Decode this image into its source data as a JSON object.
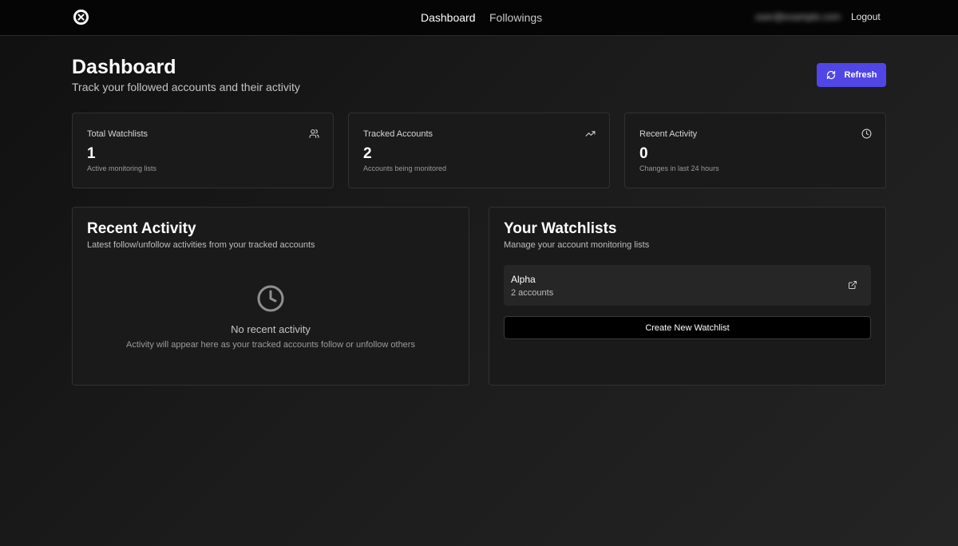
{
  "nav": {
    "items": [
      "Dashboard",
      "Followings"
    ],
    "user_email": "user@example.com",
    "logout_label": "Logout"
  },
  "header": {
    "title": "Dashboard",
    "subtitle": "Track your followed accounts and their activity",
    "refresh_label": "Refresh"
  },
  "stats": [
    {
      "title": "Total Watchlists",
      "value": "1",
      "description": "Active monitoring lists",
      "icon": "users-icon"
    },
    {
      "title": "Tracked Accounts",
      "value": "2",
      "description": "Accounts being monitored",
      "icon": "trending-up-icon"
    },
    {
      "title": "Recent Activity",
      "value": "0",
      "description": "Changes in last 24 hours",
      "icon": "clock-icon"
    }
  ],
  "recent_activity": {
    "title": "Recent Activity",
    "subtitle": "Latest follow/unfollow activities from your tracked accounts",
    "empty_title": "No recent activity",
    "empty_description": "Activity will appear here as your tracked accounts follow or unfollow others"
  },
  "watchlists": {
    "title": "Your Watchlists",
    "subtitle": "Manage your account monitoring lists",
    "items": [
      {
        "name": "Alpha",
        "count": "2 accounts"
      }
    ],
    "create_label": "Create New Watchlist"
  },
  "colors": {
    "accent": "#5046e5",
    "card_bg": "#1a1a1a",
    "border": "#313131",
    "topbar_bg": "#050505"
  }
}
